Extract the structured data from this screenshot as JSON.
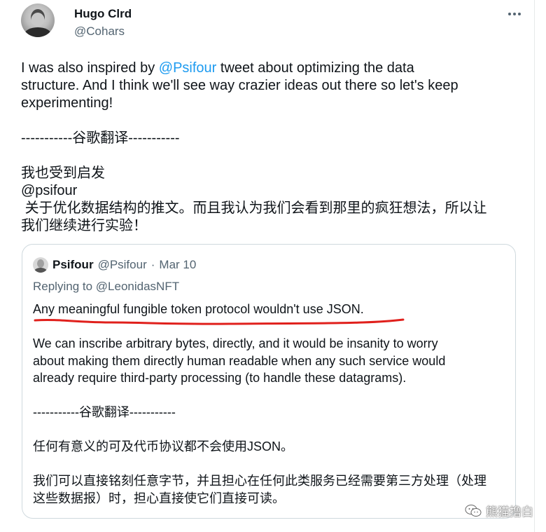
{
  "tweet": {
    "author_name": "Hugo Clrd",
    "author_handle": "@Cohars",
    "text": {
      "line1_pre": "I was also inspired by ",
      "line1_mention": "@Psifour",
      "line1_post": " tweet about optimizing the data",
      "line2": "structure. And I think we'll see way crazier ideas out there so let's keep",
      "line3": "experimenting!",
      "separator": "-----------谷歌翻译-----------",
      "cn_line1": "我也受到启发",
      "cn_line2": "@psifour",
      "cn_line3": " 关于优化数据结构的推文。而且我认为我们会看到那里的疯狂想法，所以让",
      "cn_line4": "我们继续进行实验！"
    }
  },
  "quote": {
    "author_name": "Psifour",
    "author_handle": "@Psifour",
    "dot": "·",
    "date": "Mar 10",
    "replying_prefix": "Replying to ",
    "replying_mention": "@LeonidasNFT",
    "text": {
      "line1": "Any meaningful fungible token protocol wouldn't use JSON.",
      "line2": "We can inscribe arbitrary bytes, directly, and it would be insanity to worry",
      "line3": "about making them directly human readable when any such service would",
      "line4": "already require third-party processing (to handle these datagrams).",
      "separator": "-----------谷歌翻译-----------",
      "cn_line1": "任何有意义的可及代币协议都不会使用JSON。",
      "cn_line2": "我们可以直接铭刻任意字节，并且担心在任何此类服务已经需要第三方处理（处理",
      "cn_line3": "这些数据报）时，担心直接使它们直接可读。"
    }
  },
  "watermark": {
    "text": "熊猫撸白"
  },
  "colors": {
    "accent": "#1d9bf0",
    "secondary_text": "#536471",
    "underline": "#e0201c",
    "border": "#cfd9de"
  },
  "icons": {
    "more": "more-horizontal-icon",
    "watermark": "wechat-icon"
  }
}
